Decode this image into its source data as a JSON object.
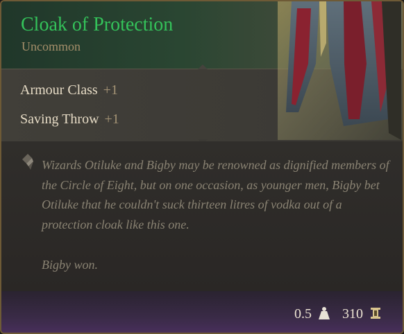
{
  "item": {
    "name": "Cloak of Protection",
    "rarity": "Uncommon"
  },
  "stats": [
    {
      "label": "Armour Class",
      "value": "+1"
    },
    {
      "label": "Saving Throw",
      "value": "+1"
    }
  ],
  "description": {
    "paragraph1": "Wizards Otiluke and Bigby may be renowned as dignified members of the Circle of Eight, but on one occasion, as younger men, Bigby bet Otiluke that he couldn't suck thirteen litres of vodka out of a protection cloak like this one.",
    "paragraph2": "Bigby won."
  },
  "footer": {
    "weight": "0.5",
    "price": "310"
  },
  "icons": {
    "weight": "weight-icon",
    "price": "gold-coin-icon",
    "description": "quill-icon",
    "art": "cloak-image"
  },
  "colors": {
    "title": "#34c25a",
    "rarity": "#a58f6a",
    "stat_label": "#e7dcc6",
    "stat_value": "#a59476",
    "description": "#8a8373",
    "border": "#6e5a36"
  }
}
